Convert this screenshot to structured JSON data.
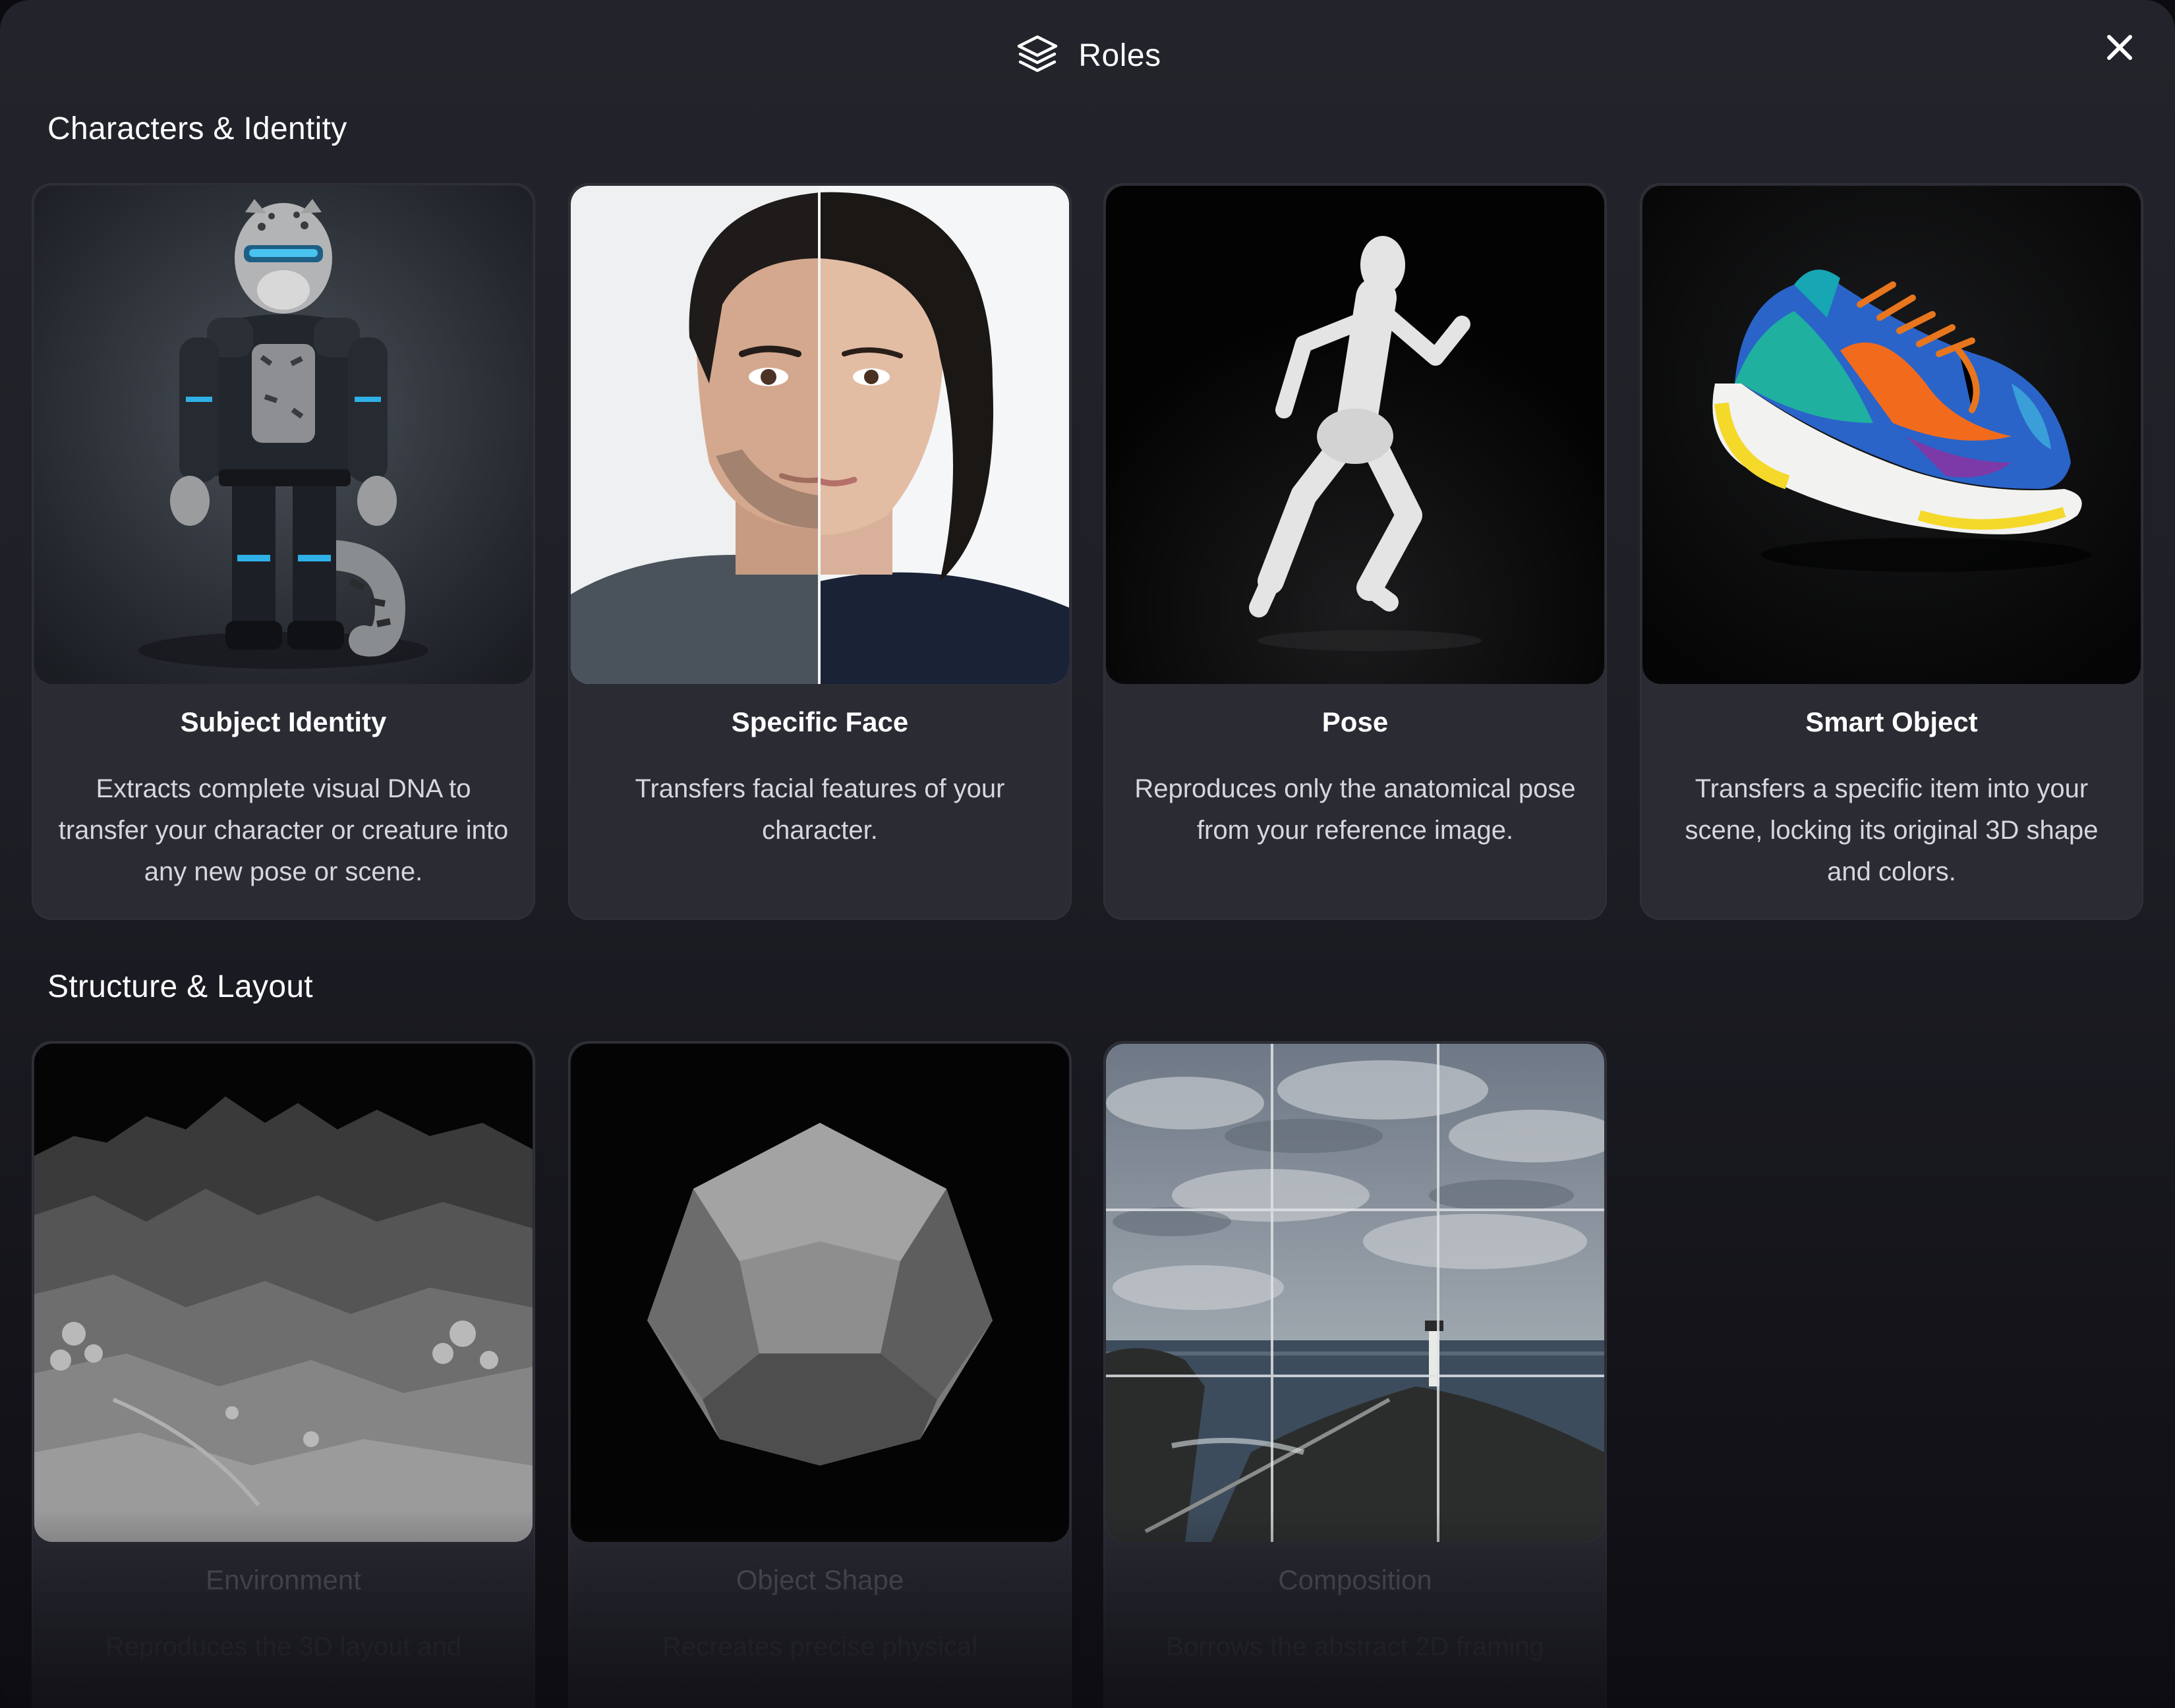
{
  "dialog": {
    "title": "Roles",
    "icon": "layers-icon",
    "close_icon": "close-icon"
  },
  "sections": [
    {
      "title": "Characters & Identity",
      "cards": [
        {
          "title": "Subject Identity",
          "description": "Extracts complete visual DNA to transfer your character or creature into any new pose or scene.",
          "image": "armored-snow-leopard-character"
        },
        {
          "title": "Specific Face",
          "description": "Transfers facial features of your character.",
          "image": "split-face-portrait"
        },
        {
          "title": "Pose",
          "description": "Reproduces only the anatomical pose from your reference image.",
          "image": "running-mannequin"
        },
        {
          "title": "Smart Object",
          "description": "Transfers a specific item into your scene, locking its original 3D shape and colors.",
          "image": "colorful-sneaker"
        }
      ]
    },
    {
      "title": "Structure & Layout",
      "cards": [
        {
          "title": "Environment",
          "description": "Reproduces the 3D layout and",
          "image": "grayscale-mountain-terrain"
        },
        {
          "title": "Object Shape",
          "description": "Recreates precise physical",
          "image": "gray-dodecahedron"
        },
        {
          "title": "Composition",
          "description": "Borrows the abstract 2D framing",
          "image": "lighthouse-coast-with-grid"
        }
      ]
    }
  ]
}
